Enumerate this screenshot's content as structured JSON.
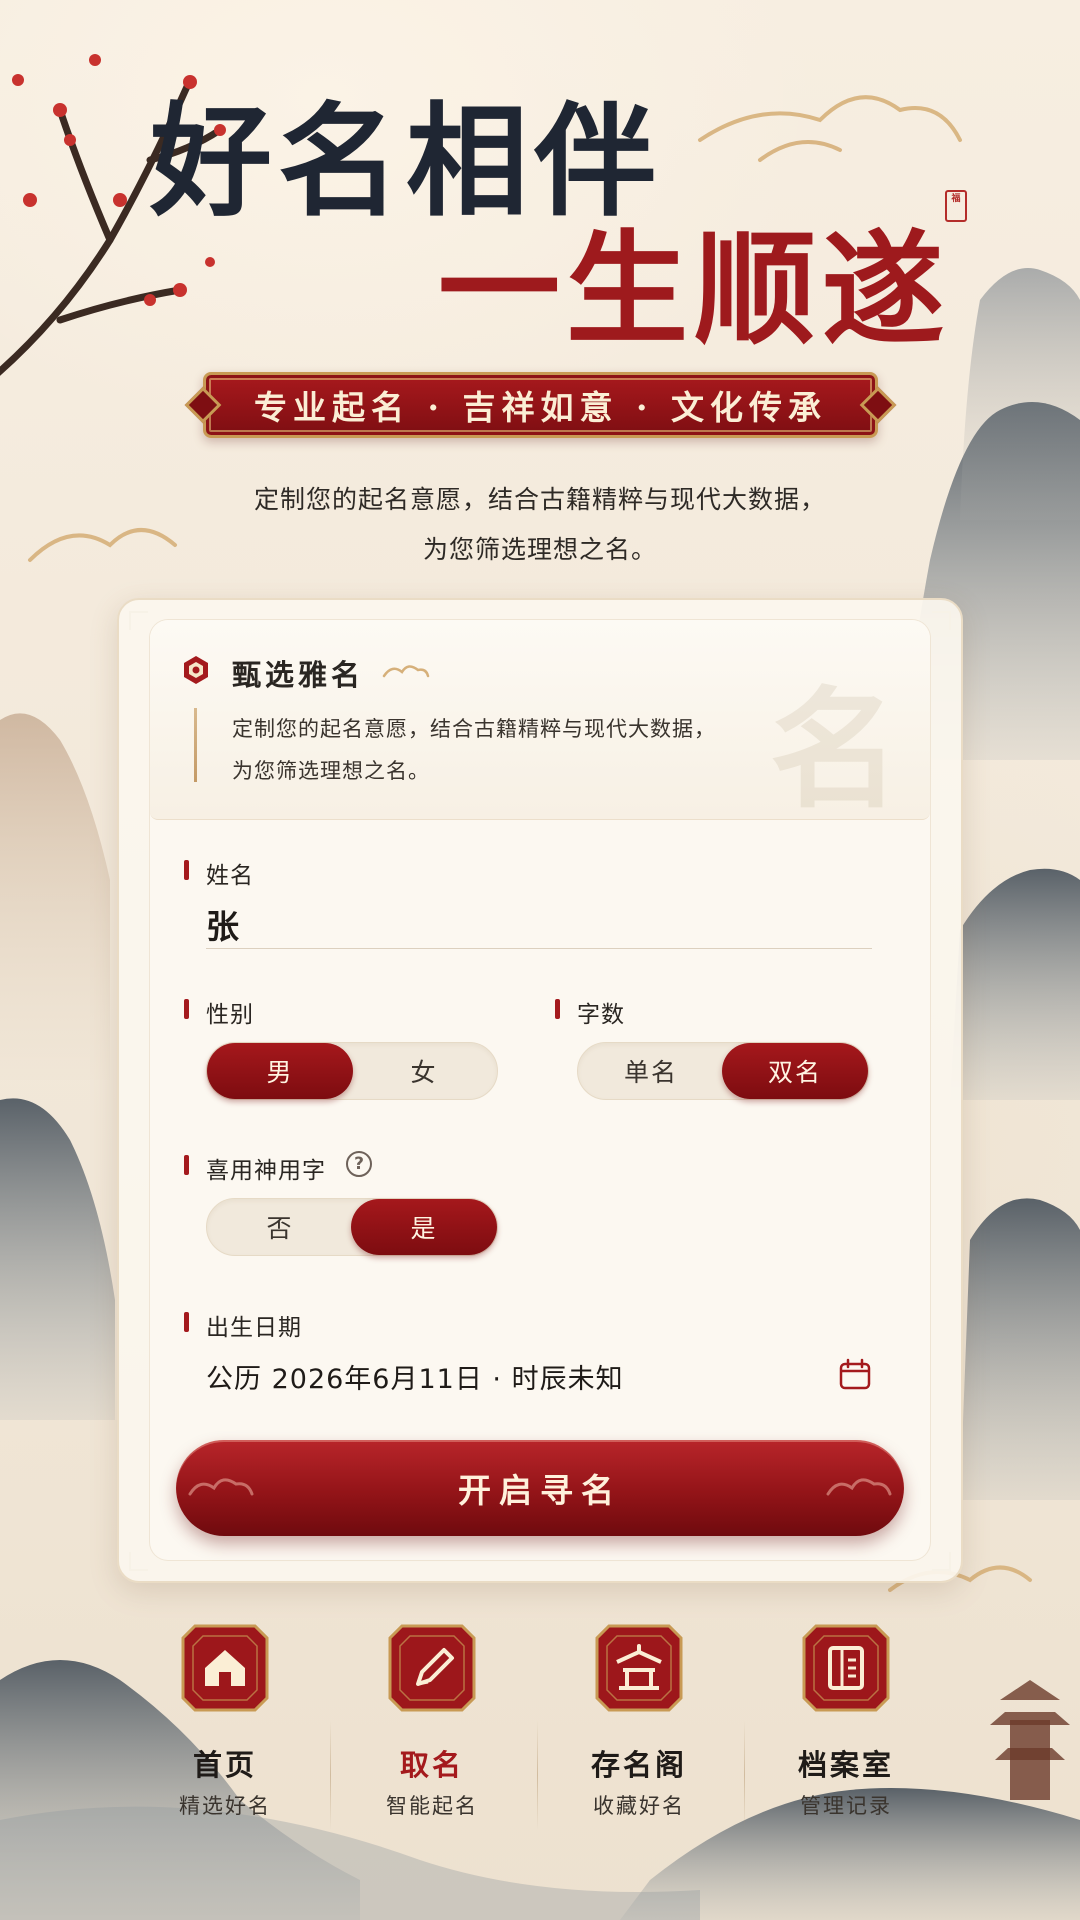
{
  "hero": {
    "line1": "好名相伴",
    "line2": "一生顺遂",
    "seal": "福"
  },
  "banner": {
    "text": "专业起名 · 吉祥如意 · 文化传承"
  },
  "intro": {
    "line1": "定制您的起名意愿，结合古籍精粹与现代大数据，",
    "line2": "为您筛选理想之名。"
  },
  "selection": {
    "title": "甄选雅名",
    "desc_line1": "定制您的起名意愿，结合古籍精粹与现代大数据，",
    "desc_line2": "为您筛选理想之名。",
    "watermark": "名"
  },
  "form": {
    "surname_label": "姓名",
    "surname_value": "张",
    "gender_label": "性别",
    "gender_options": [
      "男",
      "女"
    ],
    "gender_selected": "男",
    "count_label": "字数",
    "count_options": [
      "单名",
      "双名"
    ],
    "count_selected": "双名",
    "favored_label": "喜用神用字",
    "favored_help": "?",
    "favored_options": [
      "否",
      "是"
    ],
    "favored_selected": "是",
    "birth_label": "出生日期",
    "birth_value": "公历 2026年6月11日 · 时辰未知"
  },
  "cta": {
    "label": "开启寻名"
  },
  "nav": [
    {
      "title": "首页",
      "sub": "精选好名",
      "icon": "home-icon",
      "active": false
    },
    {
      "title": "取名",
      "sub": "智能起名",
      "icon": "pen-icon",
      "active": true
    },
    {
      "title": "存名阁",
      "sub": "收藏好名",
      "icon": "pavilion-icon",
      "active": false
    },
    {
      "title": "档案室",
      "sub": "管理记录",
      "icon": "archive-icon",
      "active": false
    }
  ],
  "colors": {
    "accent": "#a41a1d",
    "ink": "#1f2633",
    "gold": "#c89a54",
    "paper": "#f4ebde"
  }
}
